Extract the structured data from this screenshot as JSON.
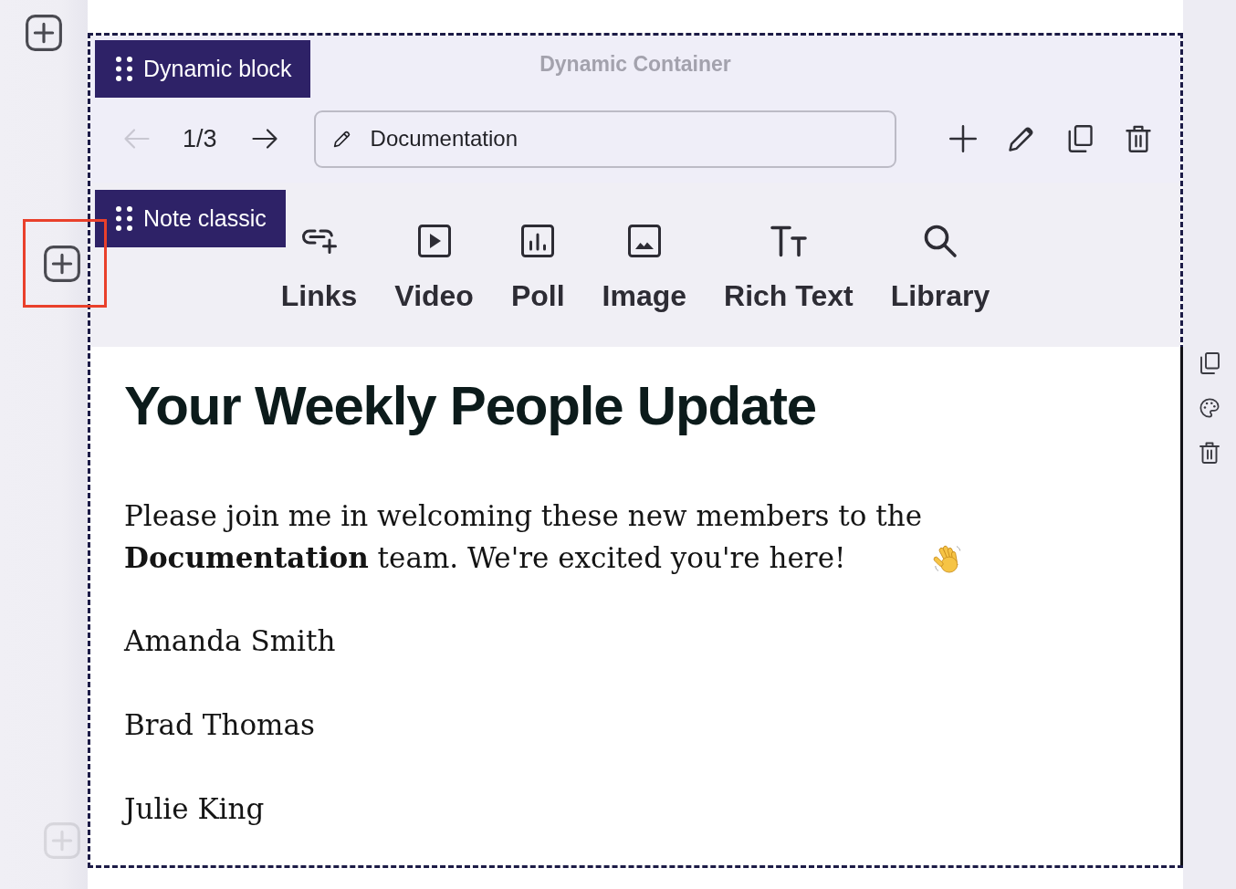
{
  "sidebar": {
    "add_buttons": [
      {
        "highlighted": false,
        "disabled": false
      },
      {
        "highlighted": true,
        "disabled": false
      },
      {
        "highlighted": false,
        "disabled": true
      }
    ]
  },
  "dynamic_block": {
    "badge": "Dynamic block",
    "title": "Dynamic Container",
    "pager": {
      "previous": {
        "disabled": true
      },
      "text": "1/3",
      "next": {
        "disabled": false
      }
    },
    "name_field": {
      "value": "Documentation"
    },
    "note_block": {
      "badge": "Note classic",
      "tools": [
        {
          "kind": "links",
          "label": "Links"
        },
        {
          "kind": "video",
          "label": "Video"
        },
        {
          "kind": "poll",
          "label": "Poll"
        },
        {
          "kind": "image",
          "label": "Image"
        },
        {
          "kind": "rich_text",
          "label": "Rich Text"
        },
        {
          "kind": "library",
          "label": "Library"
        }
      ],
      "content": {
        "heading": "Your Weekly People Update",
        "paragraph": "Please join me in welcoming these new members to the **Documentation** team. We're excited you're here!",
        "names": [
          "Amanda Smith",
          "Brad Thomas",
          "Julie King"
        ]
      }
    }
  }
}
